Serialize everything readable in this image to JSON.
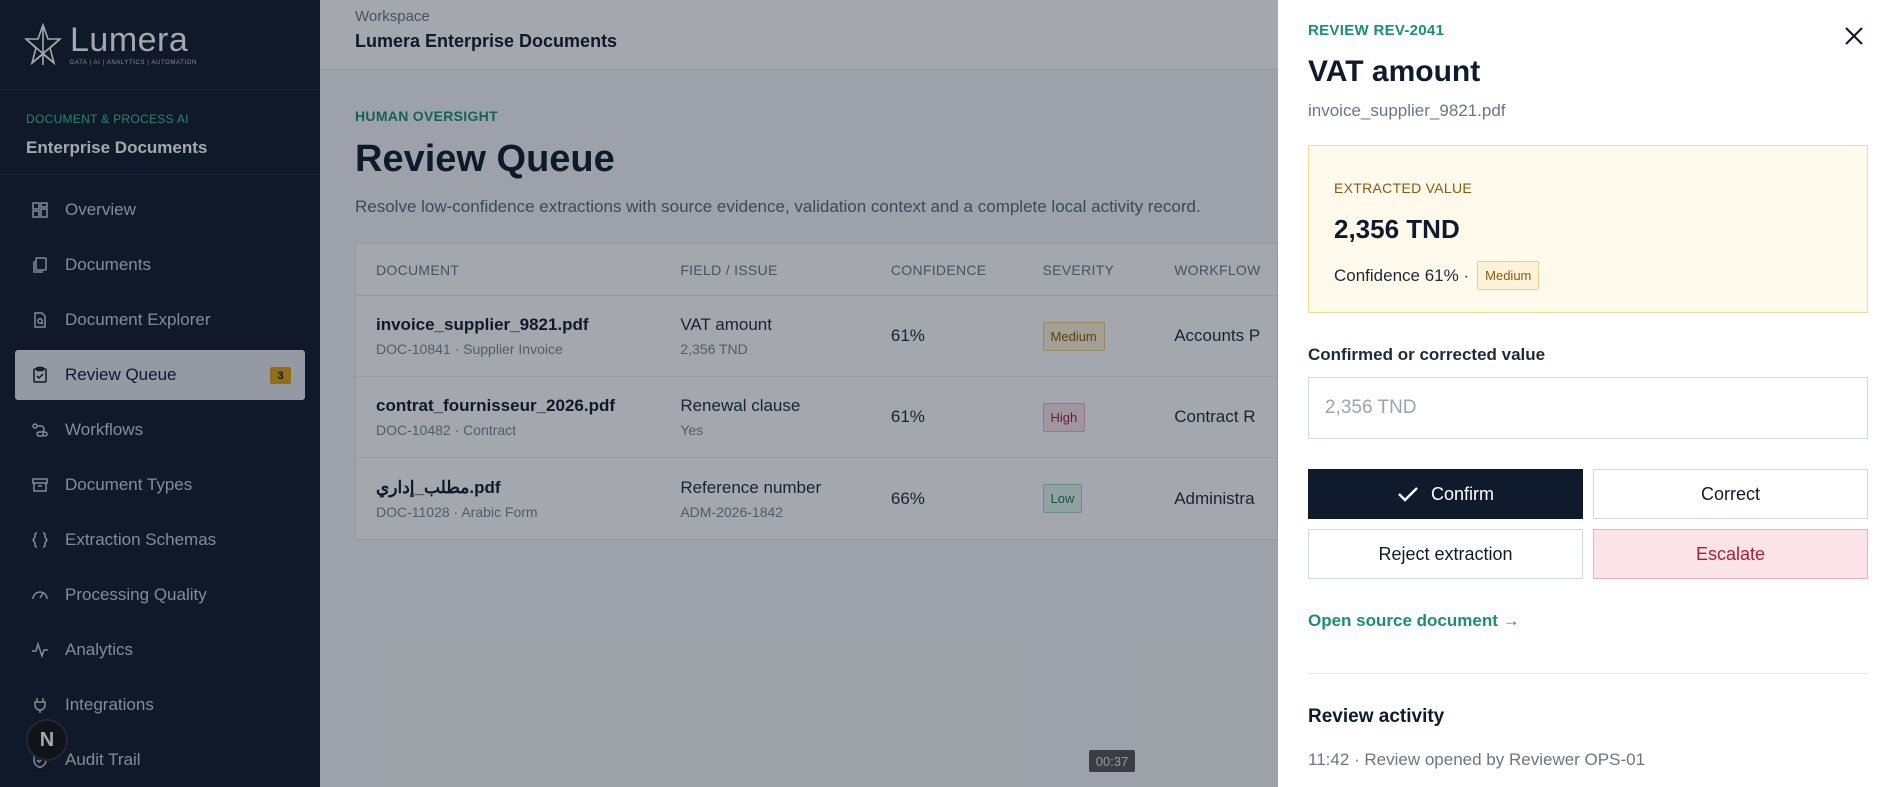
{
  "sidebar": {
    "brand_name": "Lumera",
    "brand_tagline": "DATA | AI | ANALYTICS | AUTOMATION",
    "section_kicker": "DOCUMENT & PROCESS AI",
    "section_title": "Enterprise Documents",
    "items": [
      {
        "label": "Overview",
        "icon": "grid-icon"
      },
      {
        "label": "Documents",
        "icon": "documents-icon"
      },
      {
        "label": "Document Explorer",
        "icon": "file-search-icon"
      },
      {
        "label": "Review Queue",
        "icon": "clipboard-check-icon",
        "badge": "3",
        "active": true
      },
      {
        "label": "Workflows",
        "icon": "workflow-icon"
      },
      {
        "label": "Document Types",
        "icon": "archive-icon"
      },
      {
        "label": "Extraction Schemas",
        "icon": "braces-icon"
      },
      {
        "label": "Processing Quality",
        "icon": "gauge-icon"
      },
      {
        "label": "Analytics",
        "icon": "activity-icon"
      },
      {
        "label": "Integrations",
        "icon": "plug-icon"
      },
      {
        "label": "Audit Trail",
        "icon": "shield-check-icon"
      }
    ],
    "nextjs_badge": "N"
  },
  "topbar": {
    "kicker": "Workspace",
    "title": "Lumera Enterprise Documents"
  },
  "main": {
    "kicker": "HUMAN OVERSIGHT",
    "title": "Review Queue",
    "description": "Resolve low-confidence extractions with source evidence, validation context and a complete local activity record.",
    "table": {
      "headers": [
        "DOCUMENT",
        "FIELD / ISSUE",
        "CONFIDENCE",
        "SEVERITY",
        "WORKFLOW"
      ],
      "rows": [
        {
          "doc": "invoice_supplier_9821.pdf",
          "doc_sub": "DOC-10841 · Supplier Invoice",
          "field": "VAT amount",
          "field_sub": "2,356 TND",
          "confidence": "61%",
          "severity": "Medium",
          "workflow": "Accounts P"
        },
        {
          "doc": "contrat_fournisseur_2026.pdf",
          "doc_sub": "DOC-10482 · Contract",
          "field": "Renewal clause",
          "field_sub": "Yes",
          "confidence": "61%",
          "severity": "High",
          "workflow": "Contract R"
        },
        {
          "doc": "مطلب_إداري.pdf",
          "doc_sub": "DOC-11028 · Arabic Form",
          "field": "Reference number",
          "field_sub": "ADM-2026-1842",
          "confidence": "66%",
          "severity": "Low",
          "workflow": "Administra"
        }
      ]
    }
  },
  "timer": "00:37",
  "drawer": {
    "kicker": "REVIEW REV-2041",
    "title": "VAT amount",
    "file": "invoice_supplier_9821.pdf",
    "extract_kicker": "EXTRACTED VALUE",
    "extract_value": "2,356 TND",
    "extract_confidence": "Confidence 61% ·",
    "extract_severity": "Medium",
    "input_label": "Confirmed or corrected value",
    "input_placeholder": "2,356 TND",
    "buttons": {
      "confirm": "Confirm",
      "correct": "Correct",
      "reject": "Reject extraction",
      "escalate": "Escalate"
    },
    "source_link": "Open source document →",
    "activity_title": "Review activity",
    "activity_items": [
      "11:42 · Review opened by Reviewer OPS-01"
    ]
  },
  "colors": {
    "sidebar_bg": "#0f1b2d",
    "accent": "#1a8f73",
    "warning": "#e0a310",
    "danger": "#a3203f"
  }
}
